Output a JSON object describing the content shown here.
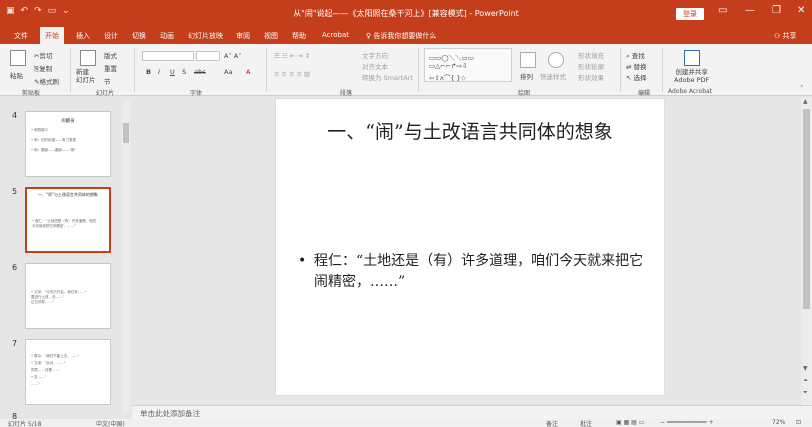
{
  "window": {
    "title": "从\"闹\"说起——《太阳照在桑干河上》[兼容模式] - PowerPoint",
    "login": "登录",
    "controls": [
      "—",
      "❐",
      "✕"
    ]
  },
  "quick_access": {
    "save_icon": "save-icon",
    "undo_icon": "undo-icon",
    "redo_icon": "redo-icon",
    "present_icon": "present-icon"
  },
  "tabs": [
    "文件",
    "开始",
    "插入",
    "设计",
    "切换",
    "动画",
    "幻灯片放映",
    "审阅",
    "视图",
    "帮助",
    "Acrobat"
  ],
  "active_tab": "开始",
  "tell_me": "告诉我你想要做什么",
  "share": "共享",
  "ribbon": {
    "clipboard": {
      "paste": "粘贴",
      "cut": "剪切",
      "copy": "复制",
      "format_painter": "格式刷",
      "label": "剪贴板"
    },
    "slides": {
      "new_slide": "新建\n幻灯片",
      "layout": "版式",
      "reset": "重置",
      "section": "节",
      "label": "幻灯片"
    },
    "font": {
      "bold": "B",
      "italic": "I",
      "underline": "U",
      "strike": "S",
      "shadow": "abc",
      "case": "Aa",
      "label": "字体"
    },
    "paragraph": {
      "text_direction": "文字方向",
      "align_text": "对齐文本",
      "smartart": "转换为 SmartArt",
      "label": "段落"
    },
    "drawing": {
      "arrange": "排列",
      "quick_styles": "快速样式",
      "fill": "形状填充",
      "outline": "形状轮廓",
      "effects": "形状效果",
      "label": "绘图"
    },
    "editing": {
      "find": "查找",
      "replace": "替换",
      "select": "选择",
      "label": "编辑"
    },
    "acrobat": {
      "create_share": "创建并共享\nAdobe PDF",
      "label": "Adobe Acrobat"
    }
  },
  "thumbnails": [
    {
      "number": "4",
      "title": "闹翻身",
      "lines": [
        "• 闹的释义",
        "• 闹：旧时用语——有力表现",
        "• 闹：翻身——翻身——\"闹\""
      ]
    },
    {
      "number": "5",
      "title": "一、\"闹\"与土改语言共同体的想象",
      "lines": [
        "• 程仁：\"土地还是（有）许多道理，咱们",
        "  今天就来把它闹精密，……\""
      ]
    },
    {
      "number": "6",
      "title": "",
      "lines": [
        "• 文采：\"今天已开会，我们来……\"",
        "  要进行土改，但……\"",
        "  过去领导……\""
      ]
    },
    {
      "number": "7",
      "title": "",
      "lines": [
        "• 群众：\"我们不能上去，……\"",
        "• 文采：\"反对，……\"",
        "  同意……还是……",
        "• 张……\"",
        "  ……\""
      ]
    },
    {
      "number": "8",
      "title": "",
      "lines": []
    }
  ],
  "slide": {
    "title": "一、“闹”与土改语言共同体的想象",
    "bullet": "程仁：“土地还是（有）许多道理，咱们今天就来把它闹精密，……”"
  },
  "notes_placeholder": "单击此处添加备注",
  "status": {
    "slide_info": "幻灯片 5/18",
    "language": "中文(中国)",
    "notes": "备注",
    "comments": "批注",
    "zoom": "72%"
  }
}
